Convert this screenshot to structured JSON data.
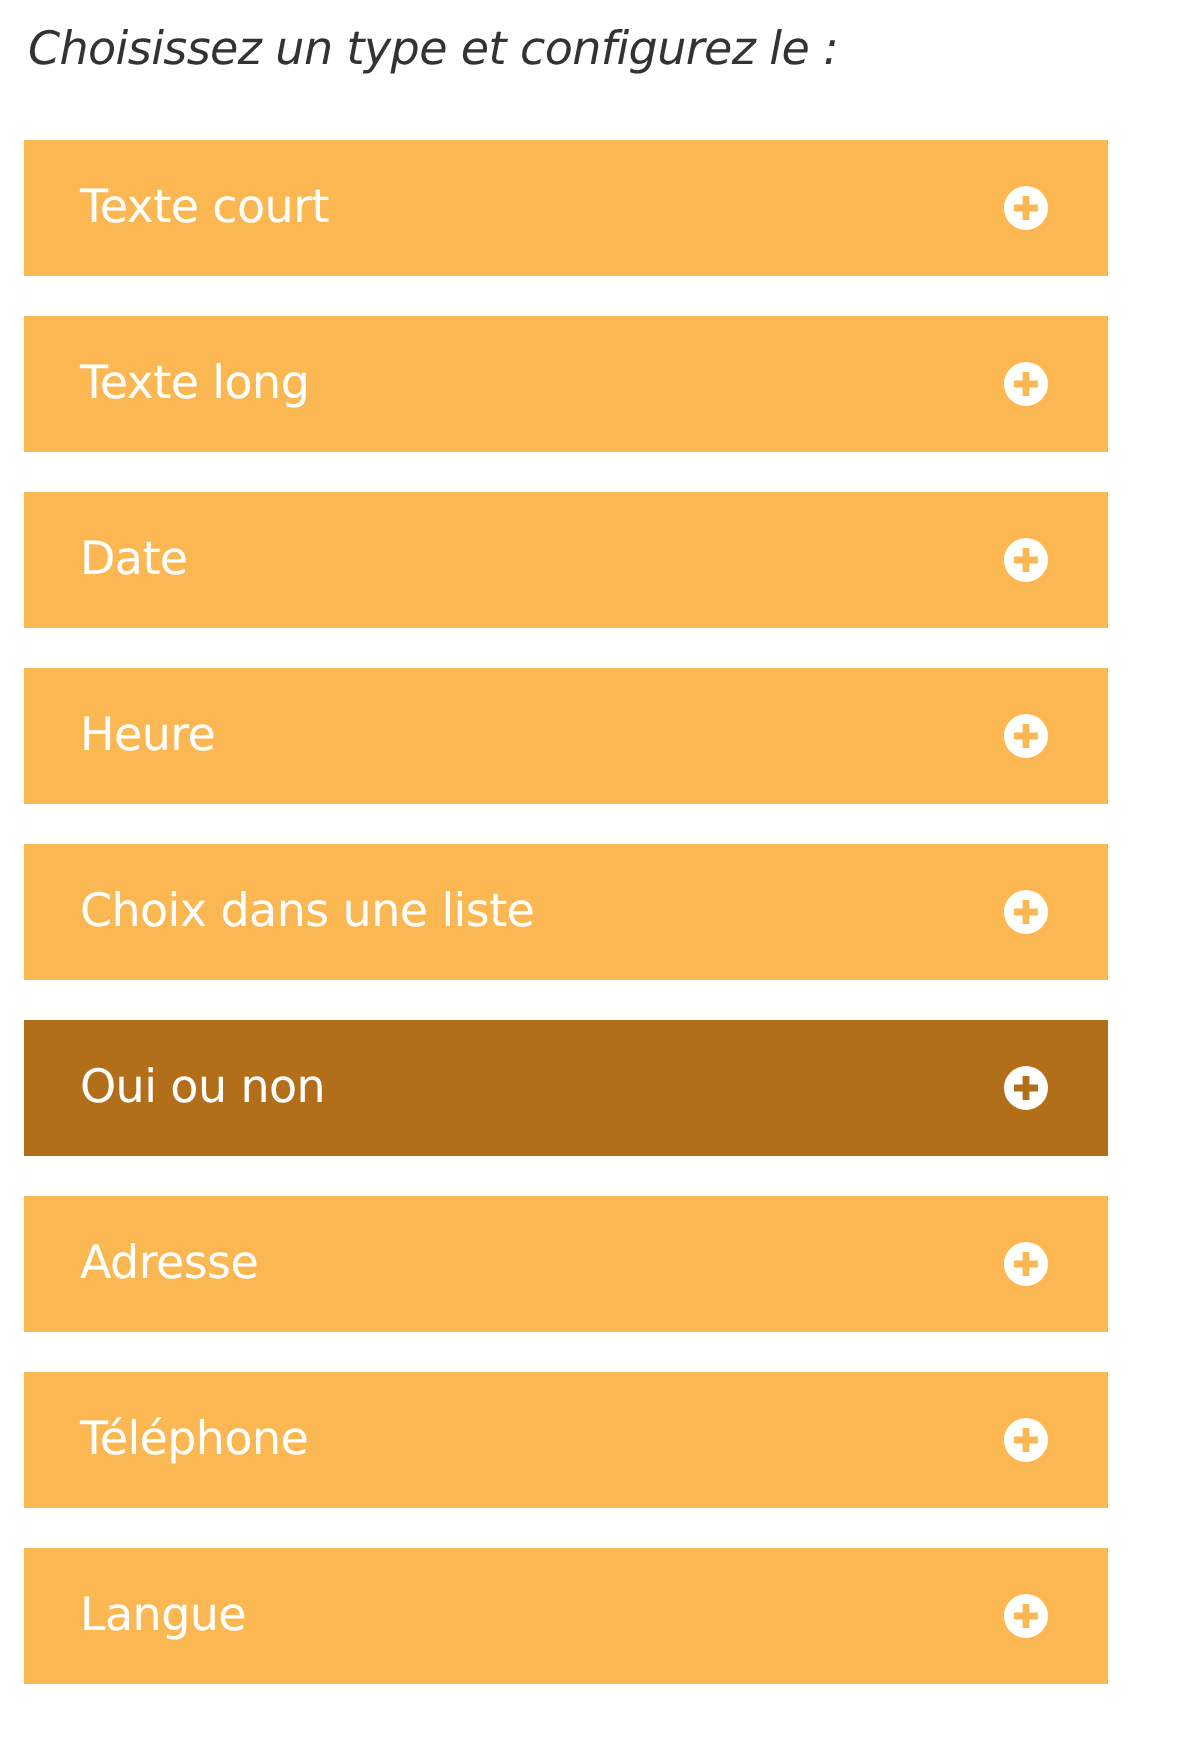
{
  "heading": "Choisissez un type et configurez le :",
  "types": [
    {
      "label": "Texte court",
      "selected": false
    },
    {
      "label": "Texte long",
      "selected": false
    },
    {
      "label": "Date",
      "selected": false
    },
    {
      "label": "Heure",
      "selected": false
    },
    {
      "label": "Choix dans une liste",
      "selected": false
    },
    {
      "label": "Oui ou non",
      "selected": true
    },
    {
      "label": "Adresse",
      "selected": false
    },
    {
      "label": "Téléphone",
      "selected": false
    },
    {
      "label": "Langue",
      "selected": false
    }
  ]
}
